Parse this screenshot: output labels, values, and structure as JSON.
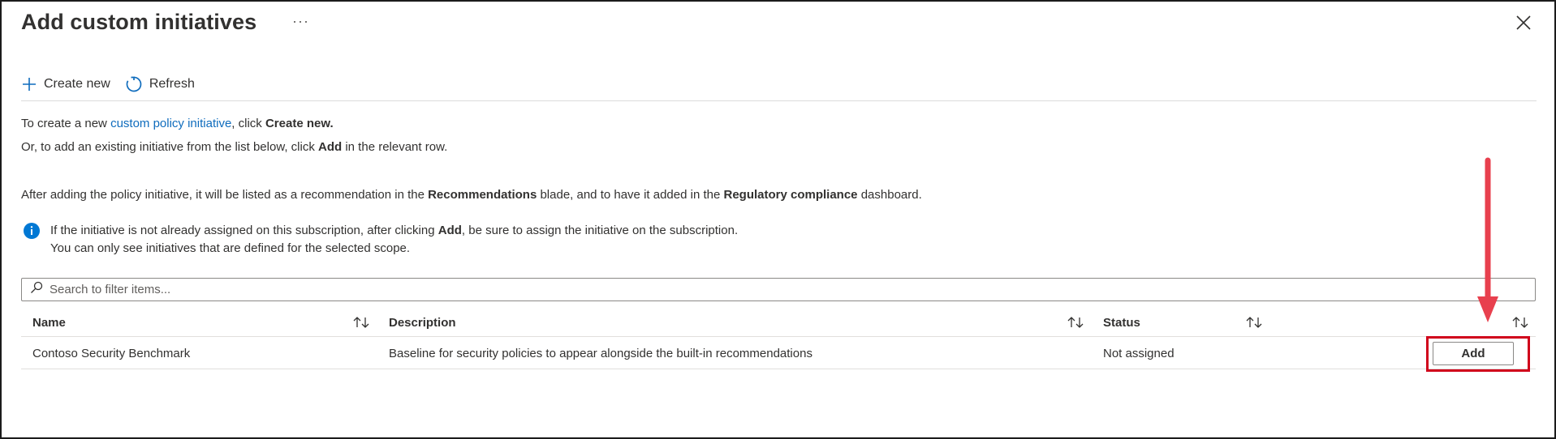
{
  "header": {
    "title": "Add custom initiatives",
    "more_label": "···"
  },
  "toolbar": {
    "create_new_label": "Create new",
    "refresh_label": "Refresh"
  },
  "intro": {
    "line1_prefix": "To create a new ",
    "line1_link": "custom policy initiative",
    "line1_middle": ", click ",
    "line1_bold": "Create new.",
    "line2_prefix": "Or, to add an existing initiative from the list below, click ",
    "line2_bold": "Add",
    "line2_suffix": " in the relevant row.",
    "line3_prefix": "After adding the policy initiative, it will be listed as a recommendation in the ",
    "line3_bold1": "Recommendations",
    "line3_middle": " blade, and to have it added in the ",
    "line3_bold2": "Regulatory compliance",
    "line3_suffix": " dashboard."
  },
  "info": {
    "line1_prefix": "If the initiative is not already assigned on this subscription, after clicking ",
    "line1_bold": "Add",
    "line1_suffix": ", be sure to assign the initiative on the subscription.",
    "line2": "You can only see initiatives that are defined for the selected scope."
  },
  "search": {
    "placeholder": "Search to filter items..."
  },
  "table": {
    "columns": [
      "Name",
      "Description",
      "Status"
    ],
    "rows": [
      {
        "name": "Contoso Security Benchmark",
        "description": "Baseline for security policies to appear alongside the built-in recommendations",
        "status": "Not assigned",
        "action": "Add"
      }
    ]
  },
  "colors": {
    "accent": "#0f6cbd",
    "info_icon": "#0078d4",
    "highlight": "#d0021b",
    "arrow": "#e8404e"
  },
  "icons": [
    "more-icon",
    "close-icon",
    "plus-icon",
    "refresh-icon",
    "info-icon",
    "search-icon",
    "sort-icon",
    "arrow-annotation"
  ]
}
